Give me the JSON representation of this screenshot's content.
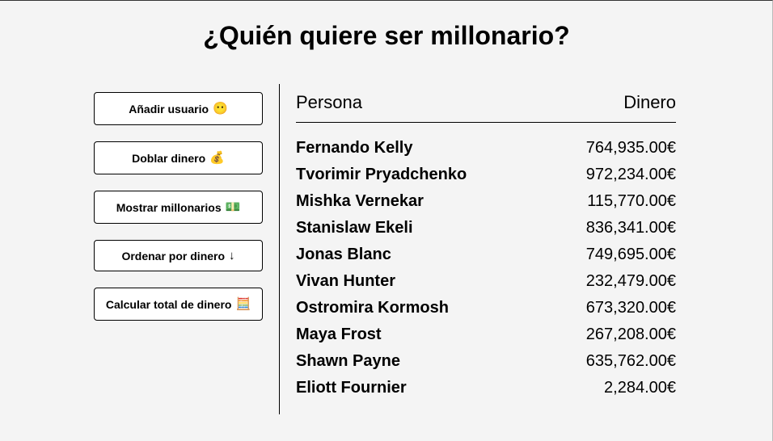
{
  "header": {
    "title": "¿Quién quiere ser millonario?"
  },
  "actions": [
    {
      "label": "Añadir usuario",
      "icon": "😶"
    },
    {
      "label": "Doblar dinero",
      "icon": "💰"
    },
    {
      "label": "Mostrar millonarios",
      "icon": "💵"
    },
    {
      "label": "Ordenar por dinero",
      "icon": "↓"
    },
    {
      "label": "Calcular total de dinero",
      "icon": "🧮"
    }
  ],
  "table": {
    "headers": {
      "person": "Persona",
      "money": "Dinero"
    },
    "rows": [
      {
        "name": "Fernando Kelly",
        "money": "764,935.00€"
      },
      {
        "name": "Tvorimir Pryadchenko",
        "money": "972,234.00€"
      },
      {
        "name": "Mishka Vernekar",
        "money": "115,770.00€"
      },
      {
        "name": "Stanislaw Ekeli",
        "money": "836,341.00€"
      },
      {
        "name": "Jonas Blanc",
        "money": "749,695.00€"
      },
      {
        "name": "Vivan Hunter",
        "money": "232,479.00€"
      },
      {
        "name": "Ostromira Kormosh",
        "money": "673,320.00€"
      },
      {
        "name": "Maya Frost",
        "money": "267,208.00€"
      },
      {
        "name": "Shawn Payne",
        "money": "635,762.00€"
      },
      {
        "name": "Eliott Fournier",
        "money": "2,284.00€"
      }
    ]
  }
}
